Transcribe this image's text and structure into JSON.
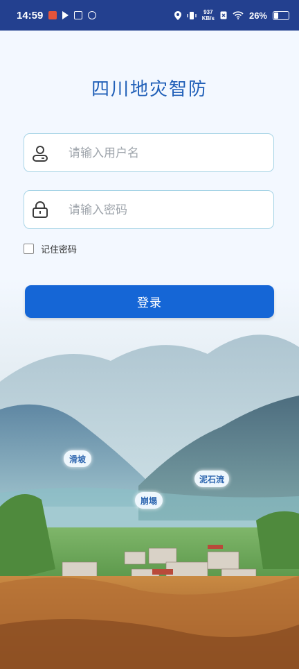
{
  "status_bar": {
    "time": "14:59",
    "net_speed_value": "937",
    "net_speed_unit": "KB/s",
    "battery": "26%",
    "battery_level": 0.26
  },
  "app": {
    "title": "四川地灾智防"
  },
  "form": {
    "username_placeholder": "请输入用户名",
    "password_placeholder": "请输入密码",
    "remember_label": "记住密码",
    "remember_checked": false,
    "login_label": "登录"
  },
  "map_labels": {
    "landslide": "滑坡",
    "collapse": "崩塌",
    "debris_flow": "泥石流"
  },
  "colors": {
    "status_bar": "#23408f",
    "accent": "#1566d6",
    "title": "#2160b8"
  }
}
